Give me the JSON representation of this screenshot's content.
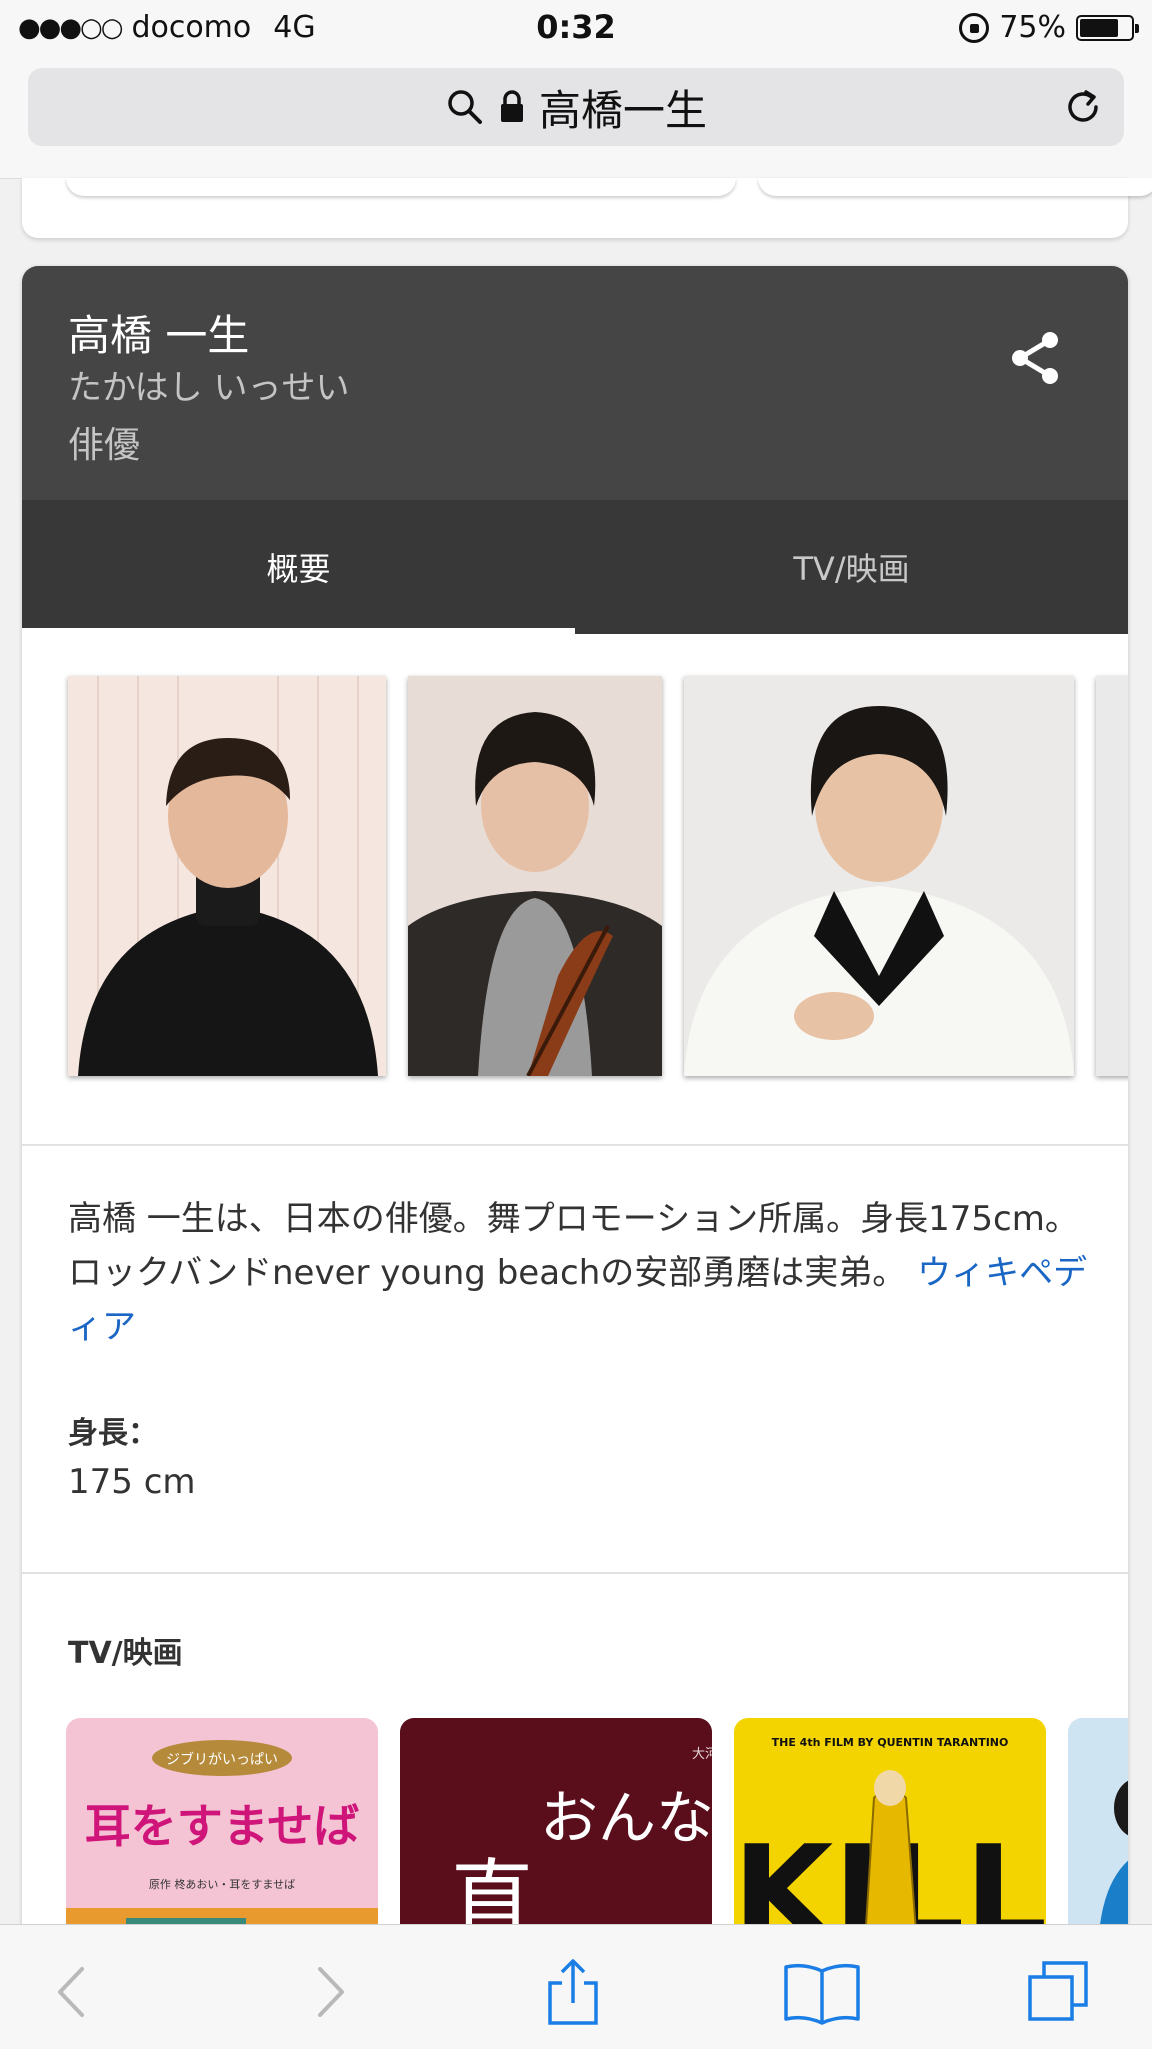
{
  "status_bar": {
    "carrier": "docomo",
    "network": "4G",
    "time": "0:32",
    "battery": "75%",
    "battery_level": 0.75
  },
  "address_bar": {
    "title": "高橋一生"
  },
  "knowledge_panel": {
    "name": "高橋 一生",
    "reading": "たかはし いっせい",
    "type": "俳優",
    "tabs": [
      {
        "label": "概要",
        "selected": true
      },
      {
        "label": "TV/映画",
        "selected": false
      }
    ],
    "description": "高橋 一生は、日本の俳優。舞プロモーション所属。身長175cm。 ロックバンドnever young beachの安部勇磨は実弟。",
    "description_link": "ウィキペディア",
    "height_label": "身長：",
    "height_value": "175 cm",
    "tv_section_title": "TV/映画",
    "posters": [
      {
        "title": "耳をすませば",
        "credit": "原作 柊あおい・耳をすませば",
        "publisher_logo": "ジブリがいっぱい"
      },
      {
        "title": "おんな",
        "kanji": "直",
        "tag": "大河ドラマ"
      },
      {
        "title": "KILL",
        "tagline": "THE 4th FILM BY QUENTIN TARANTINO"
      },
      {
        "title": ""
      }
    ]
  },
  "colors": {
    "header_bg": "#454545",
    "tab_bg": "#383838",
    "link": "#1a66c4",
    "ios_blue": "#1a7ee6"
  }
}
